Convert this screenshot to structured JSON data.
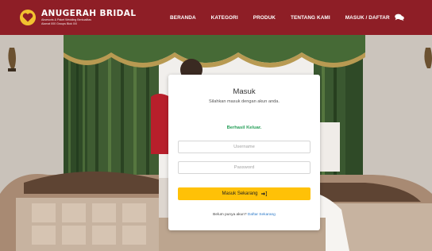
{
  "brand": {
    "name": "ANUGERAH BRIDAL",
    "tagline_1": "Aksesoris & Paket Wedding Berkualitas",
    "tagline_2": "Alamat 000 Groups Blok 0/0",
    "logo_icon": "heart-logo-icon"
  },
  "nav": {
    "items": [
      {
        "label": "BERANDA"
      },
      {
        "label": "KATEGORI"
      },
      {
        "label": "PRODUK"
      },
      {
        "label": "TENTANG KAMI"
      },
      {
        "label": "MASUK / DAFTAR"
      }
    ],
    "chat_icon": "chat-bubbles-icon"
  },
  "login": {
    "title": "Masuk",
    "subtitle": "Silahkan masuk dengan akun anda.",
    "alert": "Berhasil Keluar.",
    "username_placeholder": "Username",
    "password_placeholder": "Password",
    "submit_label": "Masuk Sekarang",
    "submit_icon": "sign-in-icon",
    "register_prompt": "Belum punya akun?",
    "register_link": "Daftar Sekarang"
  },
  "colors": {
    "navbar": "#8e1e26",
    "button": "#ffc107",
    "alert": "#28a05a",
    "link": "#2a78c8"
  }
}
